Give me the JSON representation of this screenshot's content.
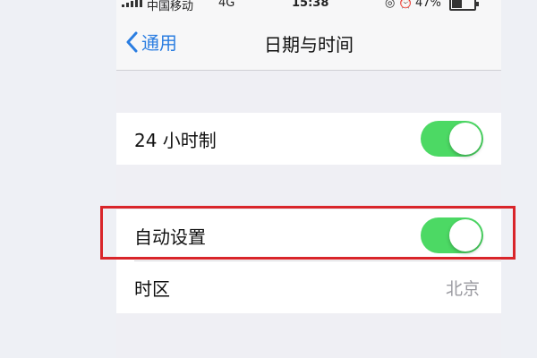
{
  "status_bar": {
    "carrier": "中国移动",
    "network": "4G",
    "time": "15:38",
    "icons": [
      "location-icon",
      "alarm-icon"
    ],
    "battery_percent": "47%"
  },
  "nav": {
    "back_label": "通用",
    "title": "日期与时间"
  },
  "settings": {
    "group1": [
      {
        "label": "24 小时制",
        "toggle_on": true
      }
    ],
    "group2": [
      {
        "label": "自动设置",
        "toggle_on": true
      },
      {
        "label": "时区",
        "value": "北京"
      }
    ]
  },
  "colors": {
    "accent": "#2a7de1",
    "toggle_on": "#4cd964",
    "highlight": "#d9252a"
  }
}
